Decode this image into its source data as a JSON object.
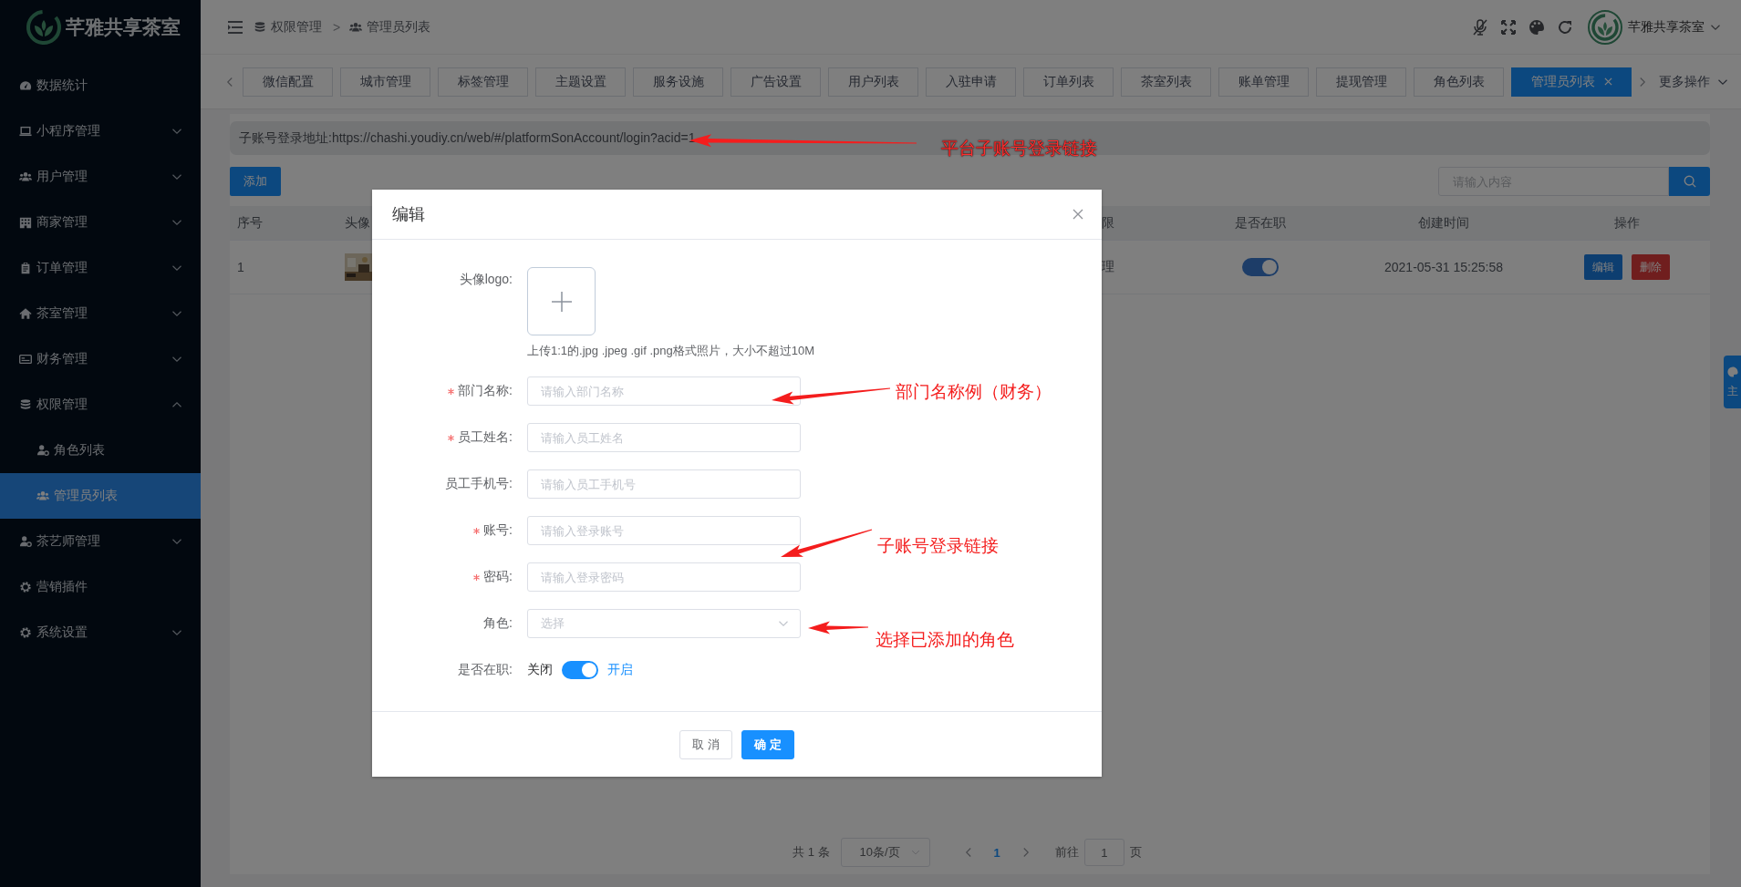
{
  "sidebar": {
    "logo_text": "芊雅共享茶室",
    "items": [
      {
        "label": "数据统计",
        "selected": false
      },
      {
        "label": "小程序管理",
        "selected": false,
        "expanded": false
      },
      {
        "label": "用户管理",
        "selected": false,
        "expanded": false
      },
      {
        "label": "商家管理",
        "selected": false,
        "expanded": false
      },
      {
        "label": "订单管理",
        "selected": false,
        "expanded": false
      },
      {
        "label": "茶室管理",
        "selected": false,
        "expanded": false
      },
      {
        "label": "财务管理",
        "selected": false,
        "expanded": false
      },
      {
        "label": "权限管理",
        "selected": false,
        "expanded": true,
        "children": [
          {
            "label": "角色列表",
            "selected": false
          },
          {
            "label": "管理员列表",
            "selected": true
          }
        ]
      },
      {
        "label": "茶艺师管理",
        "selected": false,
        "expanded": false
      },
      {
        "label": "营销插件",
        "selected": false
      },
      {
        "label": "系统设置",
        "selected": false,
        "expanded": false
      }
    ]
  },
  "topbar": {
    "breadcrumb": [
      "权限管理",
      "管理员列表"
    ],
    "separator": ">",
    "user_name": "芊雅共享茶室"
  },
  "tabs": [
    {
      "label": "微信配置",
      "selected": false
    },
    {
      "label": "城市管理",
      "selected": false
    },
    {
      "label": "标签管理",
      "selected": false
    },
    {
      "label": "主题设置",
      "selected": false
    },
    {
      "label": "服务设施",
      "selected": false
    },
    {
      "label": "广告设置",
      "selected": false
    },
    {
      "label": "用户列表",
      "selected": false
    },
    {
      "label": "入驻申请",
      "selected": false
    },
    {
      "label": "订单列表",
      "selected": false
    },
    {
      "label": "茶室列表",
      "selected": false
    },
    {
      "label": "账单管理",
      "selected": false
    },
    {
      "label": "提现管理",
      "selected": false
    },
    {
      "label": "角色列表",
      "selected": false
    },
    {
      "label": "管理员列表",
      "selected": true,
      "closable": true
    }
  ],
  "more_actions": "更多操作",
  "content": {
    "login_url_text": "子账号登录地址:https://chashi.youdiy.cn/web/#/platformSonAccount/login?acid=1",
    "add_button": "添加",
    "search": {
      "placeholder": "请输入内容"
    },
    "table": {
      "columns": [
        "序号",
        "头像",
        "限",
        "是否在职",
        "创建时间",
        "操作"
      ],
      "rows": [
        {
          "index": "1",
          "column_3": "理",
          "on_duty": true,
          "created": "2021-05-31 15:25:58",
          "actions": [
            {
              "label": "编辑",
              "kind": "primary"
            },
            {
              "label": "删除",
              "kind": "danger"
            }
          ]
        }
      ]
    },
    "pagination": {
      "total": "共 1 条",
      "page_size": "10条/页",
      "pages": [
        {
          "label": "1",
          "selected": true
        }
      ],
      "goto_label": "前往",
      "goto_value": "1",
      "goto_suffix": "页"
    }
  },
  "theme_button": {
    "label": "主"
  },
  "dialog": {
    "title": "编辑",
    "fields": [
      {
        "kind": "upload",
        "label": "头像logo:",
        "required": false,
        "hint": "上传1:1的.jpg .jpeg .gif .png格式照片，大小不超过10M"
      },
      {
        "kind": "input",
        "label": "部门名称:",
        "required": true,
        "placeholder": "请输入部门名称"
      },
      {
        "kind": "input",
        "label": "员工姓名:",
        "required": true,
        "placeholder": "请输入员工姓名"
      },
      {
        "kind": "input",
        "label": "员工手机号:",
        "required": false,
        "placeholder": "请输入员工手机号"
      },
      {
        "kind": "input",
        "label": "账号:",
        "required": true,
        "placeholder": "请输入登录账号"
      },
      {
        "kind": "input",
        "label": "密码:",
        "required": true,
        "placeholder": "请输入登录密码"
      },
      {
        "kind": "select",
        "label": "角色:",
        "required": false,
        "placeholder": "选择"
      },
      {
        "kind": "switch",
        "label": "是否在职:",
        "required": false,
        "off_text": "关闭",
        "on_text": "开启",
        "on": true
      }
    ],
    "buttons": [
      {
        "label": "取 消",
        "kind": "default"
      },
      {
        "label": "确 定",
        "kind": "primary"
      }
    ]
  },
  "annotations": [
    {
      "text": "平台子账号登录链接"
    },
    {
      "text": "部门名称例（财务）"
    },
    {
      "text": "子账号登录链接"
    },
    {
      "text": "选择已添加的角色"
    }
  ]
}
